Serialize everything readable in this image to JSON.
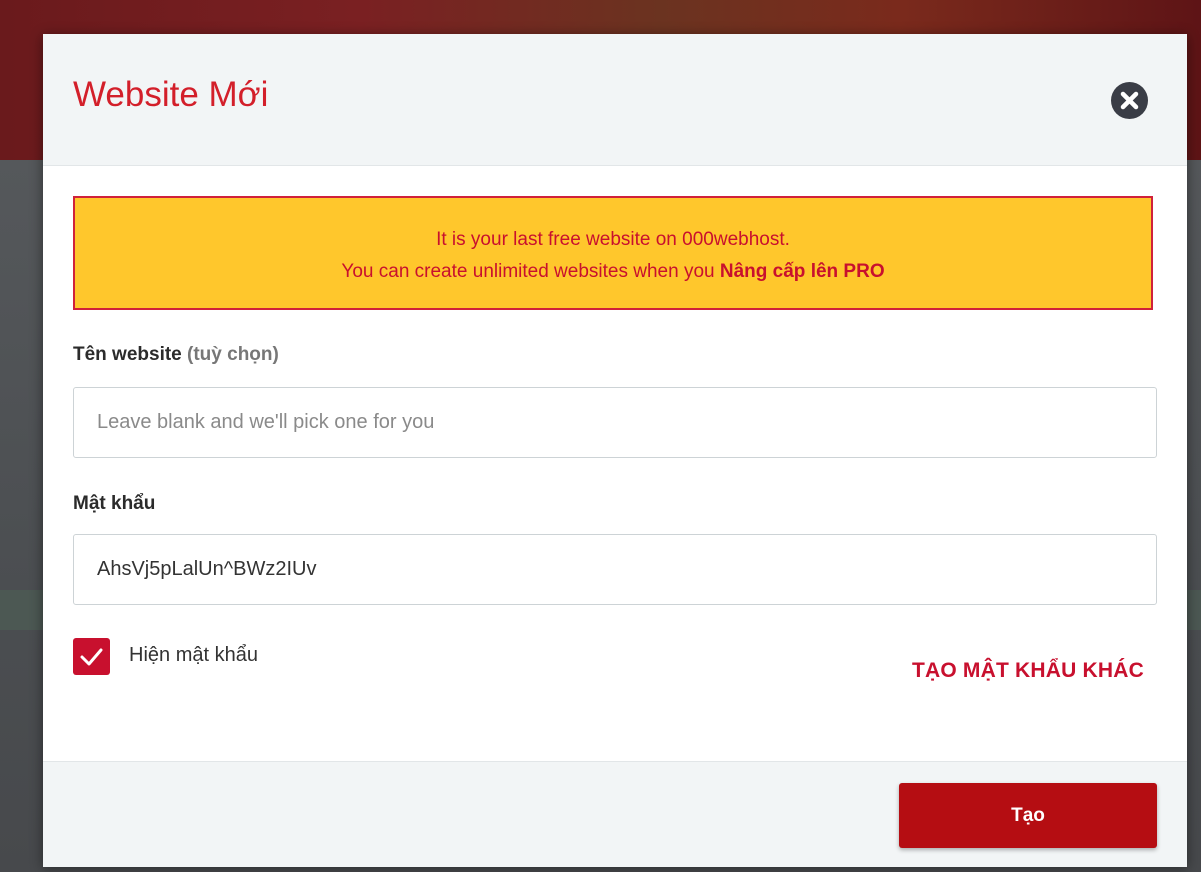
{
  "modal": {
    "title": "Website Mới",
    "close_icon": "close-circle-icon"
  },
  "alert": {
    "line1": "It is your last free website on 000webhost.",
    "line2_prefix": "You can create unlimited websites when you ",
    "upgrade_link": "Nâng cấp lên PRO"
  },
  "website_name": {
    "label": "Tên website",
    "optional": "(tuỳ chọn)",
    "value": "",
    "placeholder": "Leave blank and we'll pick one for you"
  },
  "password": {
    "label": "Mật khẩu",
    "value": "AhsVj5pLalUn^BWz2IUv"
  },
  "show_password": {
    "label": "Hiện mật khẩu",
    "checked": true
  },
  "regenerate_label": "TẠO MẬT KHẨU KHÁC",
  "footer": {
    "create_label": "Tạo"
  },
  "colors": {
    "accent": "#c8102e",
    "alert_bg": "#ffc72c",
    "create_button": "#b50d12"
  }
}
